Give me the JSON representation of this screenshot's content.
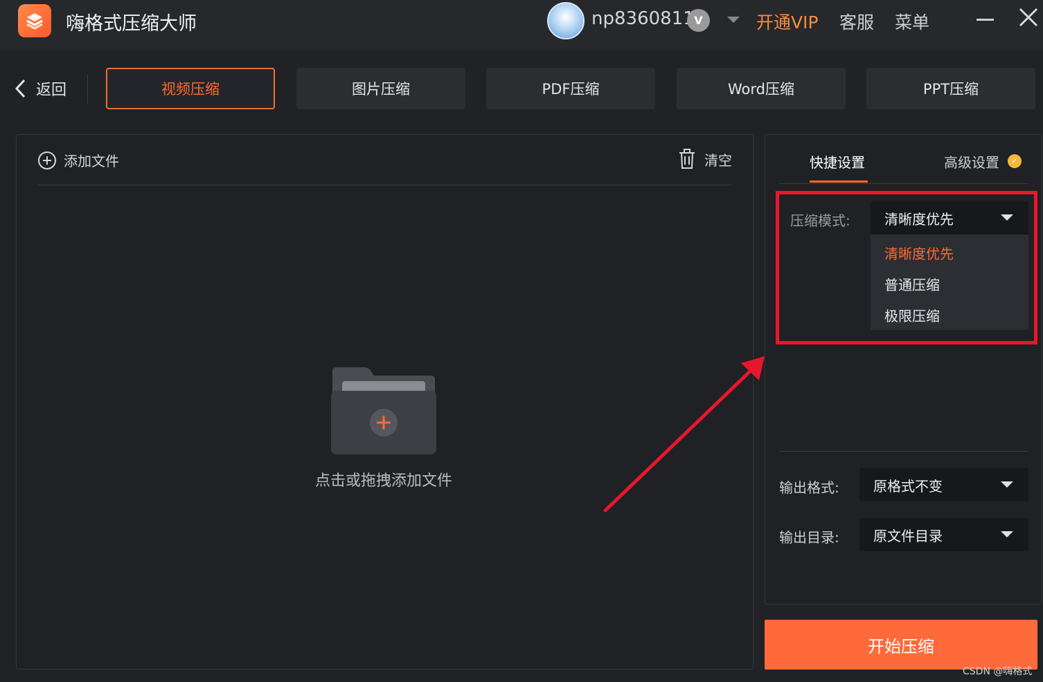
{
  "app": {
    "title": "嗨格式压缩大师",
    "username": "np8360811",
    "vip_badge": "V",
    "open_vip": "开通VIP",
    "service": "客服",
    "menu": "菜单"
  },
  "nav": {
    "back_label": "返回",
    "tabs": [
      {
        "label": "视频压缩",
        "active": true
      },
      {
        "label": "图片压缩",
        "active": false
      },
      {
        "label": "PDF压缩",
        "active": false
      },
      {
        "label": "Word压缩",
        "active": false
      },
      {
        "label": "PPT压缩",
        "active": false
      }
    ]
  },
  "file_panel": {
    "add_file": "添加文件",
    "clear": "清空",
    "drop_text": "点击或拖拽添加文件"
  },
  "settings": {
    "tabs": [
      "快捷设置",
      "高级设置"
    ],
    "mode_label": "压缩模式:",
    "mode_value": "清晰度优先",
    "mode_options": [
      "清晰度优先",
      "普通压缩",
      "极限压缩"
    ],
    "output_format_label": "输出格式:",
    "output_format_value": "原格式不变",
    "output_dir_label": "输出目录:",
    "output_dir_value": "原文件目录"
  },
  "start_button": "开始压缩",
  "watermark": "CSDN @嗨格式",
  "colors": {
    "accent": "#ff6a2e",
    "vip": "#ff8a3c",
    "highlight": "#e8162c",
    "background": "#202226"
  }
}
